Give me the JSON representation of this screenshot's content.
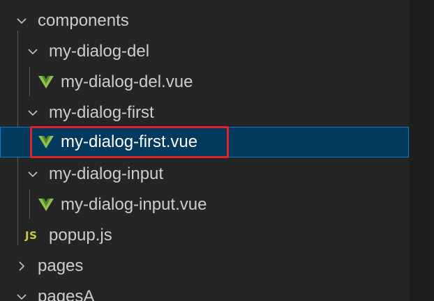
{
  "explorer": {
    "items": [
      {
        "id": "components",
        "label": "components",
        "type": "folder",
        "expanded": true,
        "depth": 0
      },
      {
        "id": "my-dialog-del",
        "label": "my-dialog-del",
        "type": "folder",
        "expanded": true,
        "depth": 1
      },
      {
        "id": "my-dialog-del-vue",
        "label": "my-dialog-del.vue",
        "type": "vue",
        "depth": 2
      },
      {
        "id": "my-dialog-first",
        "label": "my-dialog-first",
        "type": "folder",
        "expanded": true,
        "depth": 1
      },
      {
        "id": "my-dialog-first-vue",
        "label": "my-dialog-first.vue",
        "type": "vue",
        "depth": 2,
        "selected": true
      },
      {
        "id": "my-dialog-input",
        "label": "my-dialog-input",
        "type": "folder",
        "expanded": true,
        "depth": 1
      },
      {
        "id": "my-dialog-input-vue",
        "label": "my-dialog-input.vue",
        "type": "vue",
        "depth": 2
      },
      {
        "id": "popup-js",
        "label": "popup.js",
        "type": "js",
        "depth": 1
      },
      {
        "id": "pages",
        "label": "pages",
        "type": "folder",
        "expanded": false,
        "depth": 0
      },
      {
        "id": "pagesA",
        "label": "pagesA",
        "type": "folder",
        "expanded": true,
        "depth": 0
      }
    ],
    "js_badge": "JS"
  },
  "colors": {
    "selection_bg": "#04395e",
    "selection_border": "#007fd4",
    "highlight_box": "#e0202a",
    "vue_green": "#41b883",
    "vue_dark": "#8dc149",
    "js_yellow": "#cbcb41"
  }
}
